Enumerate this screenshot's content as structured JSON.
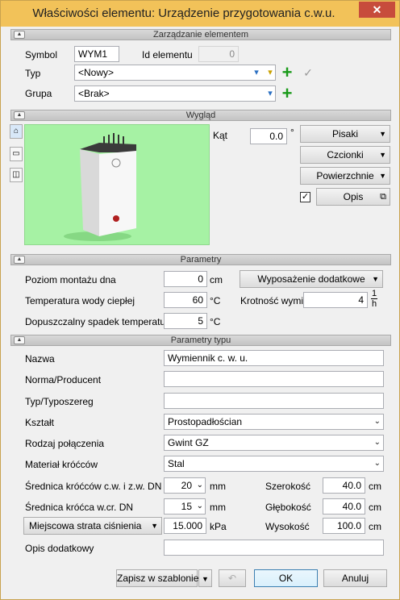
{
  "window": {
    "title": "Właściwości elementu: Urządzenie przygotowania c.w.u.",
    "close_symbol": "✕"
  },
  "sections": {
    "management": "Zarządzanie elementem",
    "appearance": "Wygląd",
    "parameters": "Parametry",
    "type_parameters": "Parametry typu"
  },
  "management": {
    "symbol_label": "Symbol",
    "symbol_value": "WYM1",
    "id_label": "Id elementu",
    "id_value": "0",
    "type_label": "Typ",
    "type_value": "<Nowy>",
    "group_label": "Grupa",
    "group_value": "<Brak>"
  },
  "appearance": {
    "angle_label": "Kąt",
    "angle_value": "0.0",
    "angle_unit": "°",
    "pens_button": "Pisaki",
    "fonts_button": "Czcionki",
    "surfaces_button": "Powierzchnie",
    "description_button": "Opis",
    "description_checked": "✓"
  },
  "parameters": {
    "mount_level_label": "Poziom montażu dna",
    "mount_level_value": "0",
    "mount_level_unit": "cm",
    "water_temp_label": "Temperatura wody ciepłej",
    "water_temp_value": "60",
    "water_temp_unit": "°C",
    "temp_drop_label": "Dopuszczalny spadek temperatury",
    "temp_drop_value": "5",
    "temp_drop_unit": "°C",
    "extra_equipment_button": "Wyposażenie dodatkowe",
    "exchange_label": "Krotność wymiany",
    "exchange_value": "4",
    "exchange_unit_top": "1",
    "exchange_unit_bottom": "h"
  },
  "type_parameters": {
    "name_label": "Nazwa",
    "name_value": "Wymiennik c. w. u.",
    "producer_label": "Norma/Producent",
    "producer_value": "",
    "series_label": "Typ/Typoszereg",
    "series_value": "",
    "shape_label": "Kształt",
    "shape_value": "Prostopadłościan",
    "connection_label": "Rodzaj połączenia",
    "connection_value": "Gwint GZ",
    "material_label": "Materiał króćców",
    "material_value": "Stal",
    "diam_cwu_label": "Średnica króćców c.w. i z.w. DN",
    "diam_cwu_value": "20",
    "diam_cwu_unit": "mm",
    "diam_wcr_label": "Średnica króćca w.cr. DN",
    "diam_wcr_value": "15",
    "diam_wcr_unit": "mm",
    "loss_combo": "Miejscowa strata ciśnienia",
    "loss_value": "15.000",
    "loss_unit": "kPa",
    "width_label": "Szerokość",
    "width_value": "40.0",
    "width_unit": "cm",
    "depth_label": "Głębokość",
    "depth_value": "40.0",
    "depth_unit": "cm",
    "height_label": "Wysokość",
    "height_value": "100.0",
    "height_unit": "cm",
    "extra_desc_label": "Opis dodatkowy",
    "extra_desc_value": ""
  },
  "footer": {
    "save_template": "Zapisz w szablonie",
    "ok": "OK",
    "cancel": "Anuluj"
  }
}
